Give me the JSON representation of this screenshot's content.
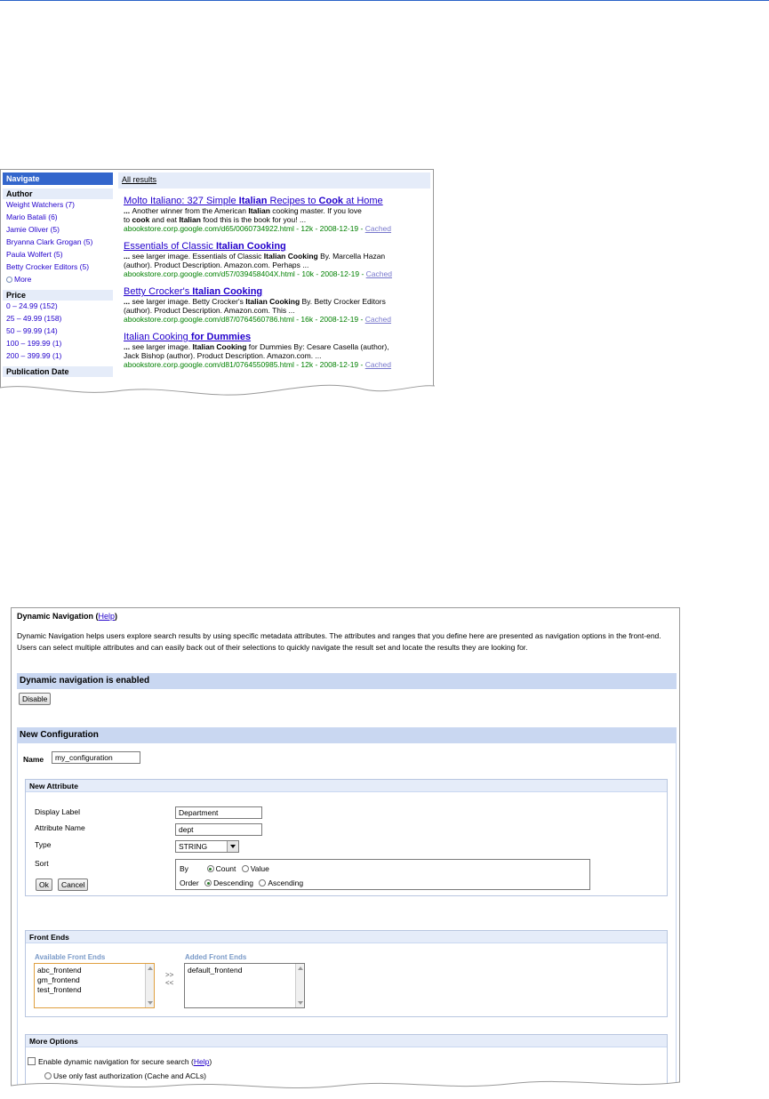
{
  "search_results": {
    "nav_title": "Navigate",
    "facets": [
      {
        "name": "Author",
        "items": [
          "Weight Watchers (7)",
          "Mario Batali (6)",
          "Jamie Oliver (5)",
          "Bryanna Clark Grogan (5)",
          "Paula Wolfert (5)",
          "Betty Crocker Editors (5)"
        ],
        "more": "More"
      },
      {
        "name": "Price",
        "items": [
          "0 – 24.99 (152)",
          "25 – 49.99 (158)",
          "50 – 99.99 (14)",
          "100 – 199.99 (1)",
          "200 – 399.99 (1)"
        ]
      },
      {
        "name": "Publication Date",
        "items": []
      }
    ],
    "results_header": "All results",
    "results": [
      {
        "title_parts": [
          "Molto Italiano: 327 Simple ",
          "Italian",
          " Recipes to ",
          "Cook",
          " at Home"
        ],
        "snippet": [
          [
            "... ",
            "Another winner from the American ",
            "Italian",
            " cooking master. If you love"
          ],
          [
            "",
            "to ",
            "cook",
            " and eat ",
            "Italian",
            " food this is the book for you! ..."
          ]
        ],
        "url": "abookstore.corp.google.com/d65/0060734922.html - 12k - 2008-12-19 - ",
        "cached": "Cached"
      },
      {
        "title_parts": [
          "Essentials of Classic ",
          "Italian Cooking"
        ],
        "snippet": [
          [
            "... ",
            "see larger image. Essentials of Classic ",
            "Italian Cooking",
            " By. Marcella Hazan"
          ],
          [
            "(author). Product Description. Amazon.com. Perhaps ..."
          ]
        ],
        "url": "abookstore.corp.google.com/d57/039458404X.html - 10k - 2008-12-19 - ",
        "cached": "Cached"
      },
      {
        "title_parts": [
          "Betty Crocker's ",
          "Italian Cooking"
        ],
        "snippet": [
          [
            "... ",
            "see larger image. Betty Crocker's ",
            "Italian Cooking",
            " By. Betty Crocker Editors"
          ],
          [
            "(author). Product Description. Amazon.com. This ..."
          ]
        ],
        "url": "abookstore.corp.google.com/d87/0764560786.html - 16k - 2008-12-19 - ",
        "cached": "Cached"
      },
      {
        "title_parts": [
          "Italian Cooking",
          " for Dummies"
        ],
        "snippet": [
          [
            "... ",
            "see larger image. ",
            "Italian Cooking",
            " for Dummies By: Cesare Casella (author),"
          ],
          [
            "Jack Bishop (author). Product Description. Amazon.com. ..."
          ]
        ],
        "url": "abookstore.corp.google.com/d81/0764550985.html - 12k - 2008-12-19 - ",
        "cached": "Cached"
      }
    ]
  },
  "admin": {
    "title": "Dynamic Navigation",
    "help_link": "Help",
    "description": "Dynamic Navigation helps users explore search results by using specific metadata attributes. The attributes and ranges that you define here are presented as navigation options in the front-end. Users can select multiple attributes and can easily back out of their selections to quickly navigate the result set and locate the results they are looking for.",
    "enabled_status": "Dynamic navigation is enabled",
    "disable_button": "Disable",
    "new_config_header": "New Configuration",
    "name_label": "Name",
    "name_value": "my_configuration",
    "new_attribute": {
      "header": "New Attribute",
      "display_label_label": "Display Label",
      "display_label_value": "Department",
      "attribute_name_label": "Attribute Name",
      "attribute_name_value": "dept",
      "type_label": "Type",
      "type_value": "STRING",
      "sort_label": "Sort",
      "by_label": "By",
      "by_options": [
        "Count",
        "Value"
      ],
      "by_selected": "Count",
      "order_label": "Order",
      "order_options": [
        "Descending",
        "Ascending"
      ],
      "order_selected": "Descending",
      "ok_button": "Ok",
      "cancel_button": "Cancel"
    },
    "front_ends": {
      "header": "Front Ends",
      "available_label": "Available Front Ends",
      "available": [
        "abc_frontend",
        "gm_frontend",
        "test_frontend"
      ],
      "added_label": "Added Front Ends",
      "added": [
        "default_frontend"
      ],
      "add_arrow": ">>",
      "remove_arrow": "<<"
    },
    "more_options": {
      "header": "More Options",
      "secure_search_label": "Enable dynamic navigation for secure search (",
      "secure_help": "Help",
      "secure_suffix": ")",
      "cut_option": "Use only fast authorization (Cache and ACLs)"
    }
  }
}
